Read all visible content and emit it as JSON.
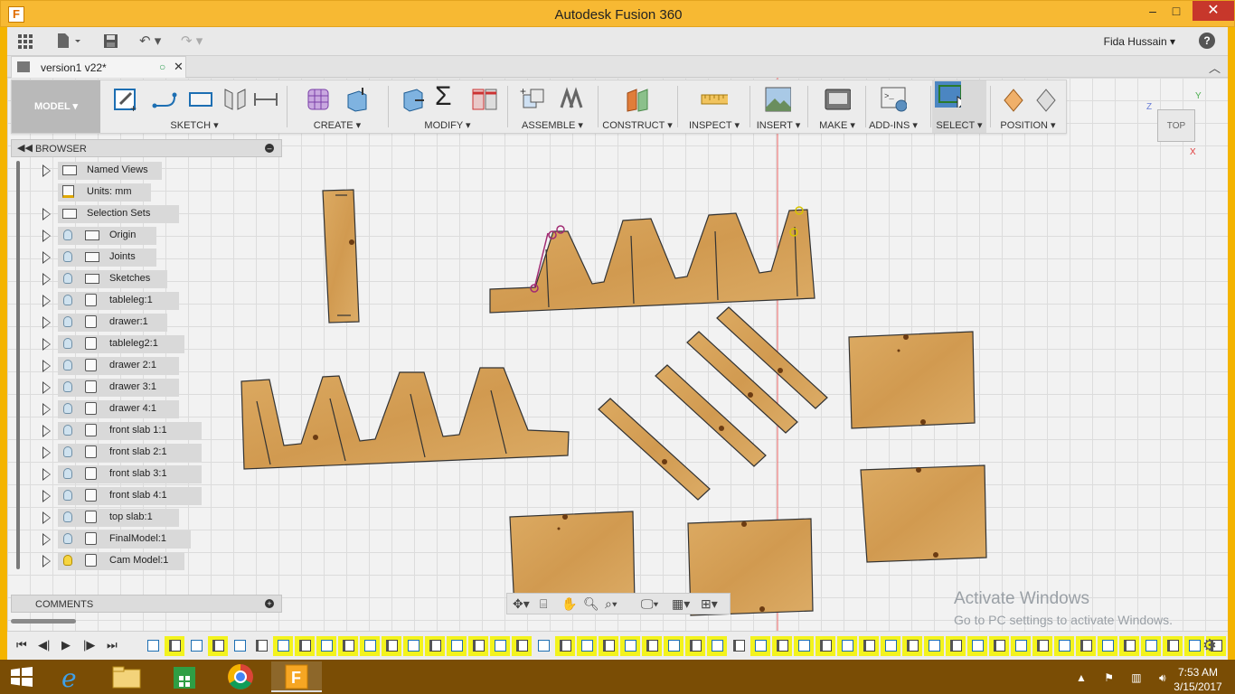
{
  "window": {
    "title": "Autodesk Fusion 360",
    "app_icon": "F",
    "minimize": "–",
    "maximize": "□",
    "close": "✕"
  },
  "quick_access": {
    "user": "Fida Hussain ▾",
    "help": "?",
    "undo": "↶ ▾",
    "redo": "↷ ▾"
  },
  "document_tab": {
    "name": "version1 v22*",
    "status": "○",
    "close": "✕"
  },
  "workspace": {
    "label": "MODEL ▾"
  },
  "ribbon": {
    "groups": [
      {
        "label": "SKETCH ▾"
      },
      {
        "label": "CREATE ▾"
      },
      {
        "label": "MODIFY ▾"
      },
      {
        "label": "ASSEMBLE ▾"
      },
      {
        "label": "CONSTRUCT ▾"
      },
      {
        "label": "INSPECT ▾"
      },
      {
        "label": "INSERT ▾"
      },
      {
        "label": "MAKE ▾"
      },
      {
        "label": "ADD-INS ▾"
      },
      {
        "label": "SELECT ▾"
      },
      {
        "label": "POSITION ▾"
      }
    ]
  },
  "browser": {
    "title": "BROWSER",
    "items": [
      {
        "label": "Named Views",
        "icon": "folder",
        "bulb": false
      },
      {
        "label": "Units: mm",
        "icon": "units",
        "bulb": false,
        "no_expand": true
      },
      {
        "label": "Selection Sets",
        "icon": "folder",
        "bulb": false
      },
      {
        "label": "Origin",
        "icon": "folder",
        "bulb": true
      },
      {
        "label": "Joints",
        "icon": "folder",
        "bulb": true
      },
      {
        "label": "Sketches",
        "icon": "folder",
        "bulb": true
      },
      {
        "label": "tableleg:1",
        "icon": "component",
        "bulb": true
      },
      {
        "label": "drawer:1",
        "icon": "component",
        "bulb": true
      },
      {
        "label": "tableleg2:1",
        "icon": "component",
        "bulb": true
      },
      {
        "label": "drawer 2:1",
        "icon": "component",
        "bulb": true
      },
      {
        "label": "drawer 3:1",
        "icon": "component",
        "bulb": true
      },
      {
        "label": "drawer 4:1",
        "icon": "component",
        "bulb": true
      },
      {
        "label": "front slab 1:1",
        "icon": "component",
        "bulb": true
      },
      {
        "label": "front slab 2:1",
        "icon": "component",
        "bulb": true
      },
      {
        "label": "front slab 3:1",
        "icon": "component",
        "bulb": true
      },
      {
        "label": "front slab 4:1",
        "icon": "component",
        "bulb": true
      },
      {
        "label": "top slab:1",
        "icon": "component",
        "bulb": true
      },
      {
        "label": "FinalModel:1",
        "icon": "component",
        "bulb": true
      },
      {
        "label": "Cam Model:1",
        "icon": "component",
        "bulb": true,
        "bulb_on": true
      }
    ]
  },
  "comments": {
    "title": "COMMENTS"
  },
  "viewcube": {
    "face": "TOP",
    "axis_z": "Z",
    "axis_y": "Y",
    "axis_x": "X"
  },
  "watermark": {
    "line1": "Activate Windows",
    "line2": "Go to PC settings to activate Windows."
  },
  "timeline": {
    "step_count": 50
  },
  "taskbar": {
    "time": "7:53 AM",
    "date": "3/15/2017"
  },
  "colors": {
    "wood": "#d9a35a",
    "wood_dark": "#c28a43",
    "title_bar": "#f7b933",
    "taskbar": "#7a4d05",
    "timeline_highlight": "#f3f31d",
    "axis_red": "#e03c3c"
  }
}
